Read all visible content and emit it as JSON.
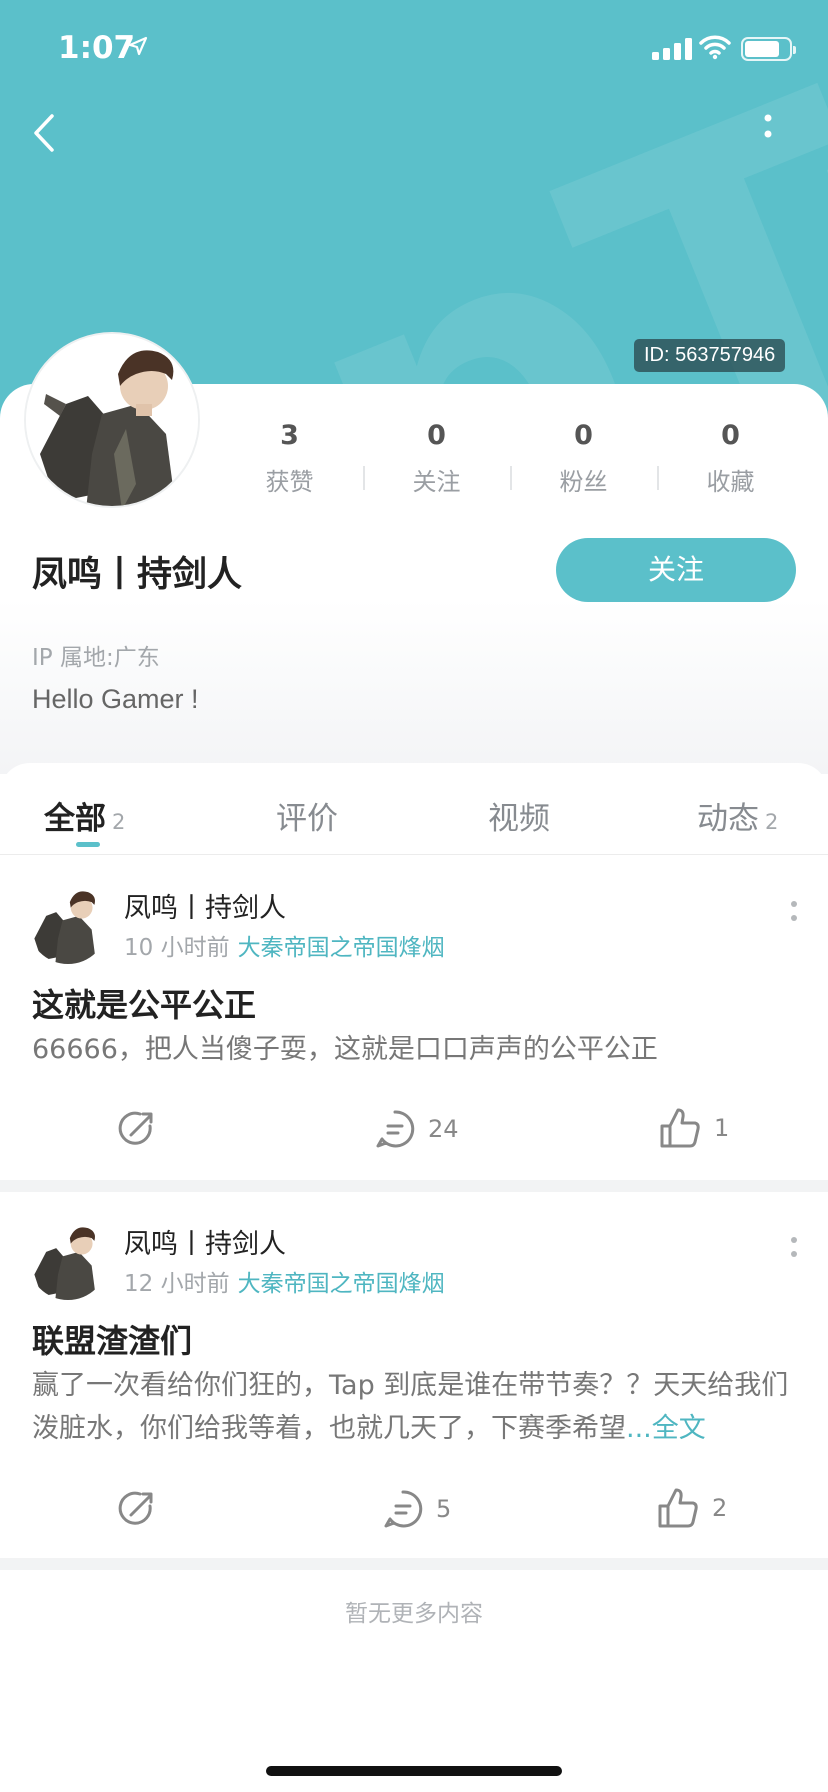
{
  "status_bar": {
    "time": "1:07"
  },
  "header": {
    "watermark": "apTap",
    "user_id": "ID: 563757946"
  },
  "stats": [
    {
      "value": "3",
      "label": "获赞"
    },
    {
      "value": "0",
      "label": "关注"
    },
    {
      "value": "0",
      "label": "粉丝"
    },
    {
      "value": "0",
      "label": "收藏"
    }
  ],
  "profile": {
    "name": "凤鸣丨持剑人",
    "follow_label": "关注",
    "ip_location": "IP 属地:广东",
    "bio": "Hello Gamer !"
  },
  "tabs": [
    {
      "label": "全部",
      "count": "2"
    },
    {
      "label": "评价",
      "count": ""
    },
    {
      "label": "视频",
      "count": ""
    },
    {
      "label": "动态",
      "count": "2"
    }
  ],
  "posts": [
    {
      "author": "凤鸣丨持剑人",
      "time": "10 小时前",
      "game": "大秦帝国之帝国烽烟",
      "title": "这就是公平公正",
      "body": "66666，把人当傻子耍，这就是口口声声的公平公正",
      "read_more": "",
      "comments": "24",
      "likes": "1"
    },
    {
      "author": "凤鸣丨持剑人",
      "time": "12 小时前",
      "game": "大秦帝国之帝国烽烟",
      "title": "联盟渣渣们",
      "body": "赢了一次看给你们狂的，Tap 到底是谁在带节奏？？天天给我们泼脏水，你们给我等着，也就几天了，下赛季希望",
      "read_more": "...全文",
      "comments": "5",
      "likes": "2"
    }
  ],
  "footer": {
    "no_more": "暂无更多内容"
  },
  "colors": {
    "accent": "#5bc0ca",
    "link": "#4fb6c1"
  }
}
